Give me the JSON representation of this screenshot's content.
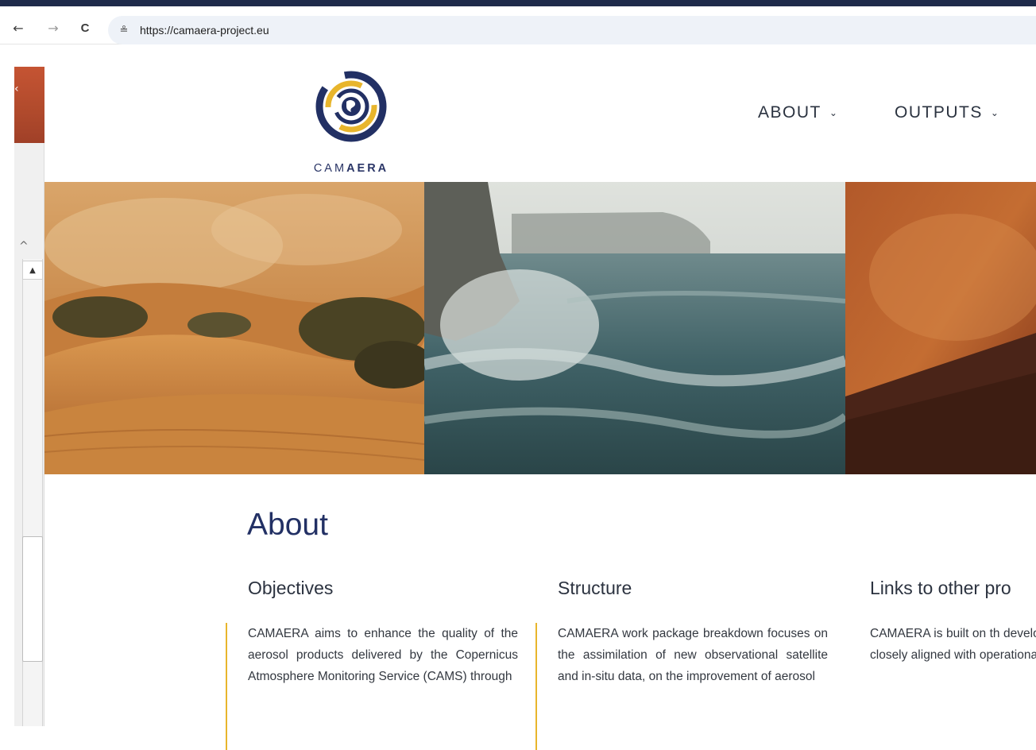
{
  "browser": {
    "back_icon": "←",
    "forward_icon": "→",
    "reload_icon": "C",
    "site_info_icon": "≗",
    "url": "https://camaera-project.eu"
  },
  "logo": {
    "text_light": "CAM",
    "text_bold": "AERA"
  },
  "nav": {
    "items": [
      {
        "label": "ABOUT"
      },
      {
        "label": "OUTPUTS"
      }
    ],
    "chevron": "⌄"
  },
  "hero": {
    "panels": [
      "desert-dunes",
      "stormy-sea-coast",
      "wildfire-smoke"
    ]
  },
  "about": {
    "title": "About",
    "columns": [
      {
        "heading": "Objectives",
        "text": "CAMAERA aims to enhance the quality of the aerosol products delivered by the Copernicus Atmosphere Monitoring Service (CAMS) through"
      },
      {
        "heading": "Structure",
        "text": "CAMAERA work package breakdown focuses on the assimilation of new observational satellite and in-situ data, on the improvement of aerosol"
      },
      {
        "heading": "Links to other pro",
        "text": "CAMAERA is built on th development efforts i closely aligned with operational CAMS serv"
      }
    ]
  },
  "colors": {
    "brand_navy": "#223064",
    "accent_gold": "#e8b52c",
    "top_strip": "#1e2b4a"
  }
}
